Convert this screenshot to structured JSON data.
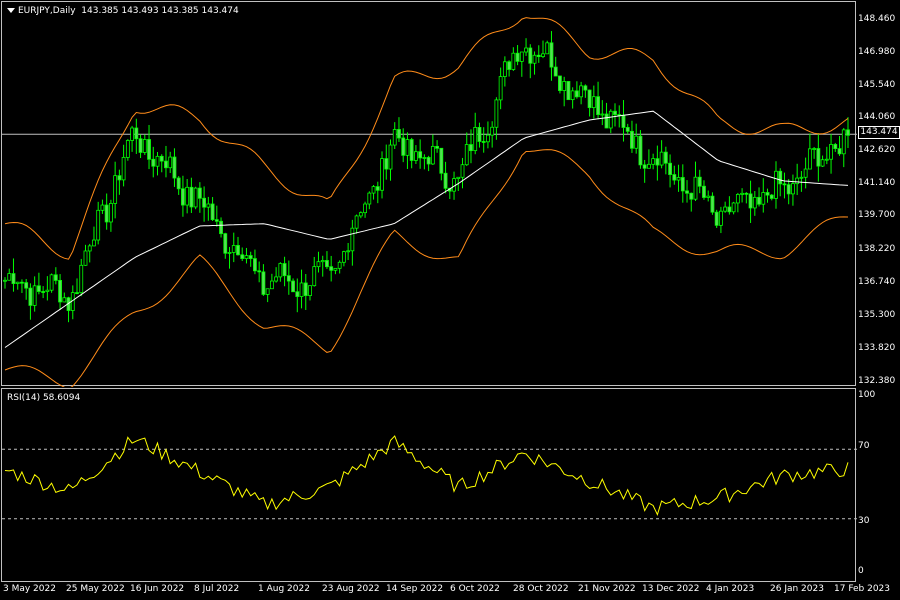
{
  "chart": {
    "symbol_title": "EURJPY,Daily",
    "ohlc_text": "143.385 143.493 143.385 143.474",
    "current_price": "143.474",
    "price_axis": [
      "148.460",
      "146.980",
      "145.540",
      "144.060",
      "142.620",
      "141.140",
      "139.700",
      "138.220",
      "136.740",
      "135.300",
      "133.820",
      "132.380"
    ],
    "rsi_title": "RSI(14) 58.6094",
    "rsi_axis": [
      "100",
      "70",
      "30",
      "0"
    ],
    "date_axis": [
      "3 May 2022",
      "25 May 2022",
      "16 Jun 2022",
      "8 Jul 2022",
      "1 Aug 2022",
      "23 Aug 2022",
      "14 Sep 2022",
      "6 Oct 2022",
      "28 Oct 2022",
      "21 Nov 2022",
      "13 Dec 2022",
      "4 Jan 2023",
      "26 Jan 2023",
      "17 Feb 2023"
    ]
  },
  "colors": {
    "candle": "#00ff00",
    "candle_body": "#55dd55",
    "bands": "#ff8c1a",
    "ma": "#ffffff",
    "rsi": "#ffff00",
    "grid": "#c0c0c0"
  },
  "chart_data": [
    {
      "type": "candlestick",
      "title": "EURJPY,Daily",
      "x": [
        "3 May 2022",
        "25 May 2022",
        "16 Jun 2022",
        "8 Jul 2022",
        "1 Aug 2022",
        "23 Aug 2022",
        "14 Sep 2022",
        "6 Oct 2022",
        "28 Oct 2022",
        "21 Nov 2022",
        "13 Dec 2022",
        "4 Jan 2023",
        "26 Jan 2023",
        "17 Feb 2023"
      ],
      "close": [
        137.0,
        136.3,
        143.5,
        140.4,
        136.9,
        137.0,
        143.2,
        141.5,
        147.8,
        145.0,
        142.5,
        139.8,
        141.0,
        143.474
      ],
      "bollinger_upper": [
        139.5,
        138.2,
        144.8,
        144.2,
        142.0,
        140.2,
        145.8,
        146.5,
        149.0,
        147.2,
        146.8,
        144.0,
        143.6,
        144.0
      ],
      "bollinger_lower": [
        133.0,
        132.5,
        135.5,
        137.8,
        135.0,
        134.0,
        139.0,
        137.8,
        143.0,
        141.8,
        139.0,
        138.2,
        138.3,
        139.8
      ],
      "moving_average": [
        134.0,
        136.0,
        138.0,
        139.4,
        139.5,
        138.8,
        139.5,
        141.3,
        143.3,
        144.1,
        144.5,
        142.3,
        141.4,
        141.2
      ],
      "ylim": [
        132.38,
        148.46
      ]
    },
    {
      "type": "line",
      "title": "RSI(14) 58.6094",
      "x": [
        "3 May 2022",
        "25 May 2022",
        "16 Jun 2022",
        "8 Jul 2022",
        "1 Aug 2022",
        "23 Aug 2022",
        "14 Sep 2022",
        "6 Oct 2022",
        "28 Oct 2022",
        "21 Nov 2022",
        "13 Dec 2022",
        "4 Jan 2023",
        "26 Jan 2023",
        "17 Feb 2023"
      ],
      "values": [
        58,
        46,
        76,
        57,
        38,
        48,
        74,
        48,
        68,
        52,
        36,
        42,
        55,
        58.6
      ],
      "ylim": [
        0,
        100
      ],
      "levels": [
        70,
        30
      ]
    }
  ]
}
